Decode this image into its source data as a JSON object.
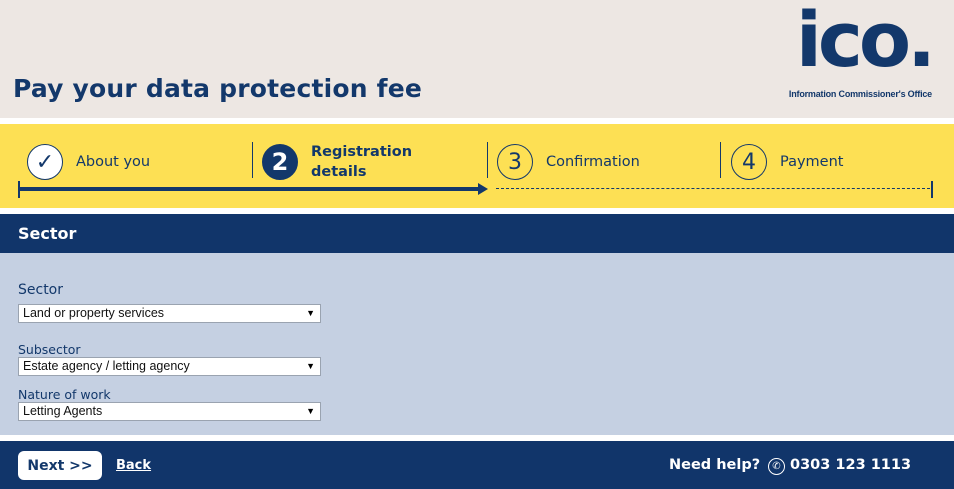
{
  "header": {
    "title": "Pay your data protection fee",
    "logo_text": "ico.",
    "logo_subtitle": "Information Commissioner's Office"
  },
  "steps": [
    {
      "number": "✓",
      "label": "About you",
      "state": "complete"
    },
    {
      "number": "2",
      "label_line1": "Registration",
      "label_line2": "details",
      "state": "current"
    },
    {
      "number": "3",
      "label": "Confirmation",
      "state": "upcoming"
    },
    {
      "number": "4",
      "label": "Payment",
      "state": "upcoming"
    }
  ],
  "progress": {
    "current_step": 2,
    "total_steps": 4
  },
  "section": {
    "title": "Sector"
  },
  "form": {
    "sector": {
      "label": "Sector",
      "value": "Land or property services"
    },
    "subsector": {
      "label": "Subsector",
      "value": "Estate agency / letting agency"
    },
    "nature_of_work": {
      "label": "Nature of work",
      "value": "Letting Agents"
    }
  },
  "footer": {
    "next_label": "Next >>",
    "back_label": "Back",
    "help_label": "Need help?",
    "phone_number": "0303 123 1113",
    "phone_icon": "phone-icon"
  },
  "colors": {
    "navy": "#13386b",
    "yellow": "#fde054",
    "header_bg": "#ede7e3",
    "form_bg": "#c5d0e2"
  },
  "icons": {
    "select_arrow": "▼"
  }
}
